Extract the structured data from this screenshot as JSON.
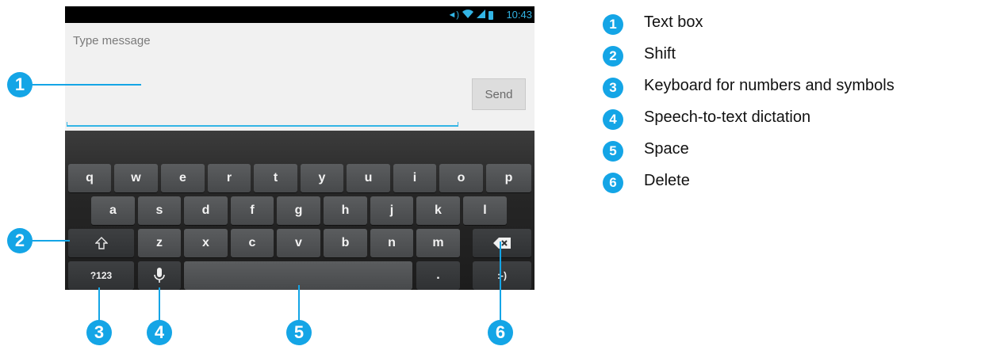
{
  "status_bar": {
    "time": "10:43",
    "icons": [
      "volume-icon",
      "wifi-icon",
      "signal-icon",
      "battery-icon"
    ]
  },
  "compose": {
    "placeholder": "Type message",
    "send_label": "Send"
  },
  "keyboard": {
    "row1": [
      "q",
      "w",
      "e",
      "r",
      "t",
      "y",
      "u",
      "i",
      "o",
      "p"
    ],
    "row2": [
      "a",
      "s",
      "d",
      "f",
      "g",
      "h",
      "j",
      "k",
      "l"
    ],
    "row3": [
      "z",
      "x",
      "c",
      "v",
      "b",
      "n",
      "m"
    ],
    "symbols_key": "?123",
    "period_key": ".",
    "emoticon_key": ":-)"
  },
  "callouts": [
    "1",
    "2",
    "3",
    "4",
    "5",
    "6"
  ],
  "legend": [
    {
      "number": "1",
      "label": "Text box"
    },
    {
      "number": "2",
      "label": "Shift"
    },
    {
      "number": "3",
      "label": "Keyboard for numbers and symbols"
    },
    {
      "number": "4",
      "label": "Speech-to-text dictation"
    },
    {
      "number": "5",
      "label": "Space"
    },
    {
      "number": "6",
      "label": "Delete"
    }
  ],
  "colors": {
    "accent": "#14a5e6",
    "holo_blue": "#33b5e5",
    "key": "#515355",
    "keyboard_bg": "#262626"
  }
}
